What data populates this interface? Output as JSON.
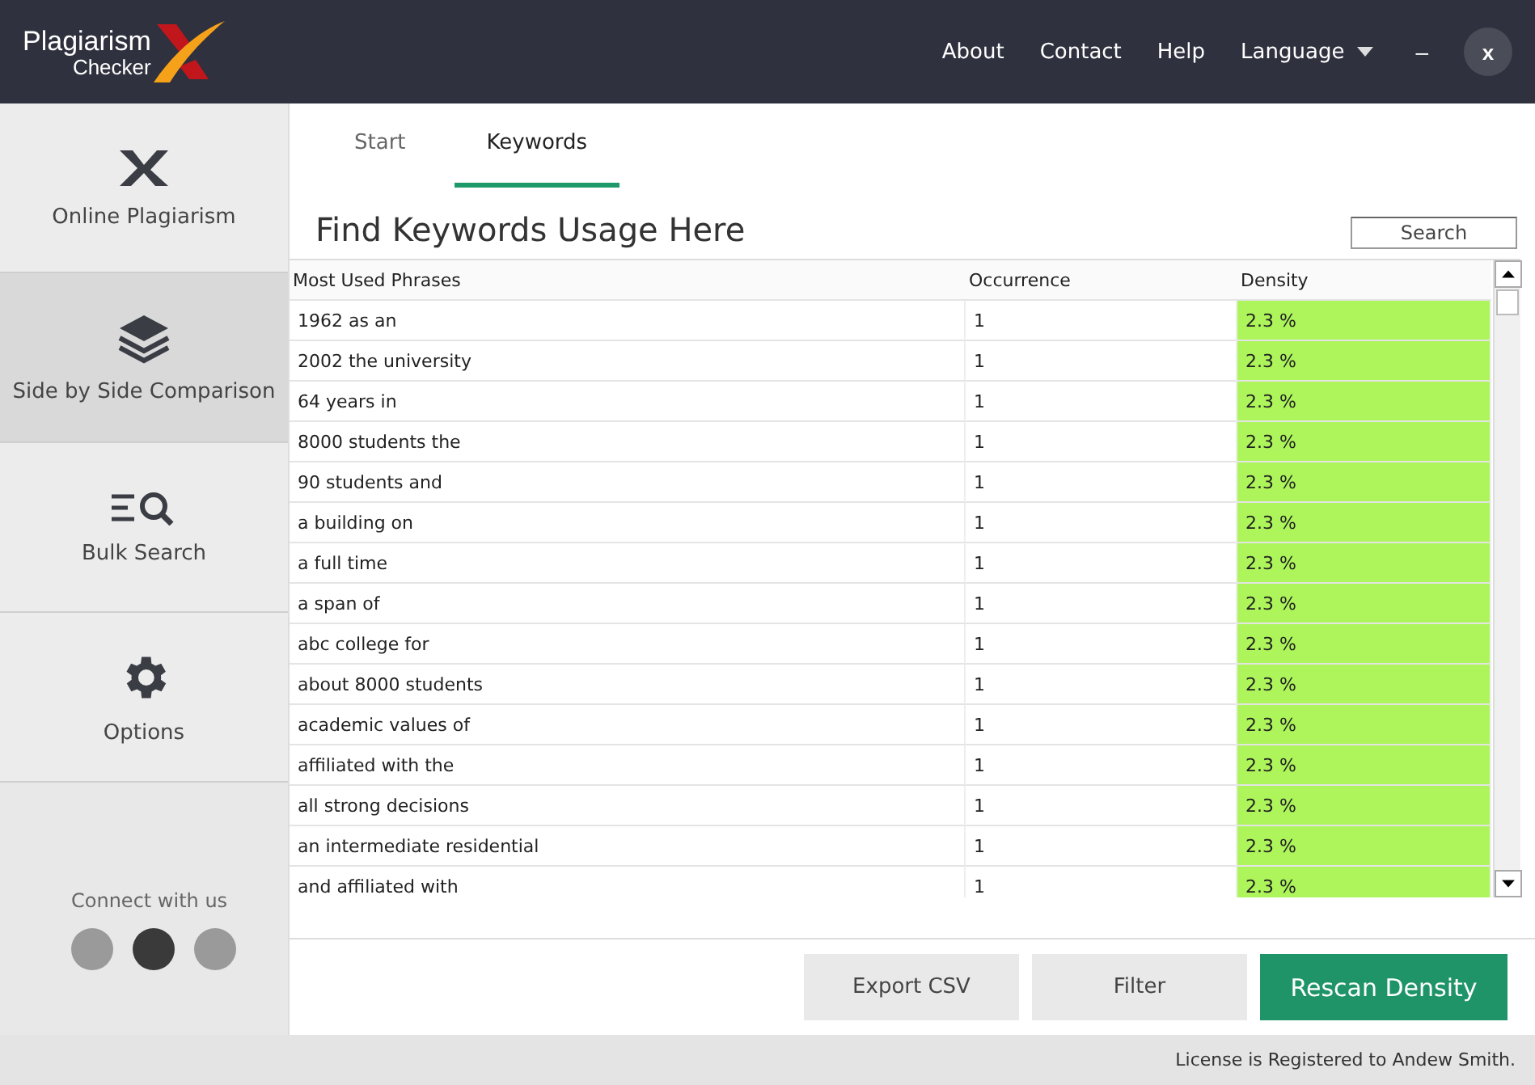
{
  "logo": {
    "line1": "Plagiarism",
    "line2": "Checker"
  },
  "nav": [
    "About",
    "Contact",
    "Help",
    "Language"
  ],
  "window_controls": {
    "minimize": "–",
    "close": "x"
  },
  "sidebar": {
    "items": [
      {
        "label": "Online Plagiarism",
        "kind": "x",
        "selected": false
      },
      {
        "label": "Side by Side Comparison",
        "kind": "layers",
        "selected": true
      },
      {
        "label": "Bulk Search",
        "kind": "search",
        "selected": false
      },
      {
        "label": "Options",
        "kind": "gear",
        "selected": false
      }
    ],
    "connect": "Connect with us"
  },
  "tabs": [
    {
      "label": "Start",
      "selected": false
    },
    {
      "label": "Keywords",
      "selected": true
    }
  ],
  "title": "Find Keywords Usage Here",
  "search": {
    "placeholder": "Search"
  },
  "table": {
    "columns": [
      "Most Used Phrases",
      "Occurrence",
      "Density"
    ],
    "rows": [
      [
        "1962 as an",
        "1",
        "2.3 %"
      ],
      [
        "2002 the university",
        "1",
        "2.3 %"
      ],
      [
        "64 years in",
        "1",
        "2.3 %"
      ],
      [
        "8000 students the",
        "1",
        "2.3 %"
      ],
      [
        "90 students and",
        "1",
        "2.3 %"
      ],
      [
        "a building on",
        "1",
        "2.3 %"
      ],
      [
        "a full time",
        "1",
        "2.3 %"
      ],
      [
        "a span of",
        "1",
        "2.3 %"
      ],
      [
        "abc college for",
        "1",
        "2.3 %"
      ],
      [
        "about 8000 students",
        "1",
        "2.3 %"
      ],
      [
        "academic values of",
        "1",
        "2.3 %"
      ],
      [
        "affiliated with the",
        "1",
        "2.3 %"
      ],
      [
        "all strong decisions",
        "1",
        "2.3 %"
      ],
      [
        "an intermediate residential",
        "1",
        "2.3 %"
      ],
      [
        "and affiliated with",
        "1",
        "2.3 %"
      ]
    ]
  },
  "buttons": [
    {
      "label": "Export CSV",
      "kind": "plain"
    },
    {
      "label": "Filter",
      "kind": "plain"
    },
    {
      "label": "Rescan Density",
      "kind": "primary"
    }
  ],
  "status": "License is Registered to Andew Smith."
}
